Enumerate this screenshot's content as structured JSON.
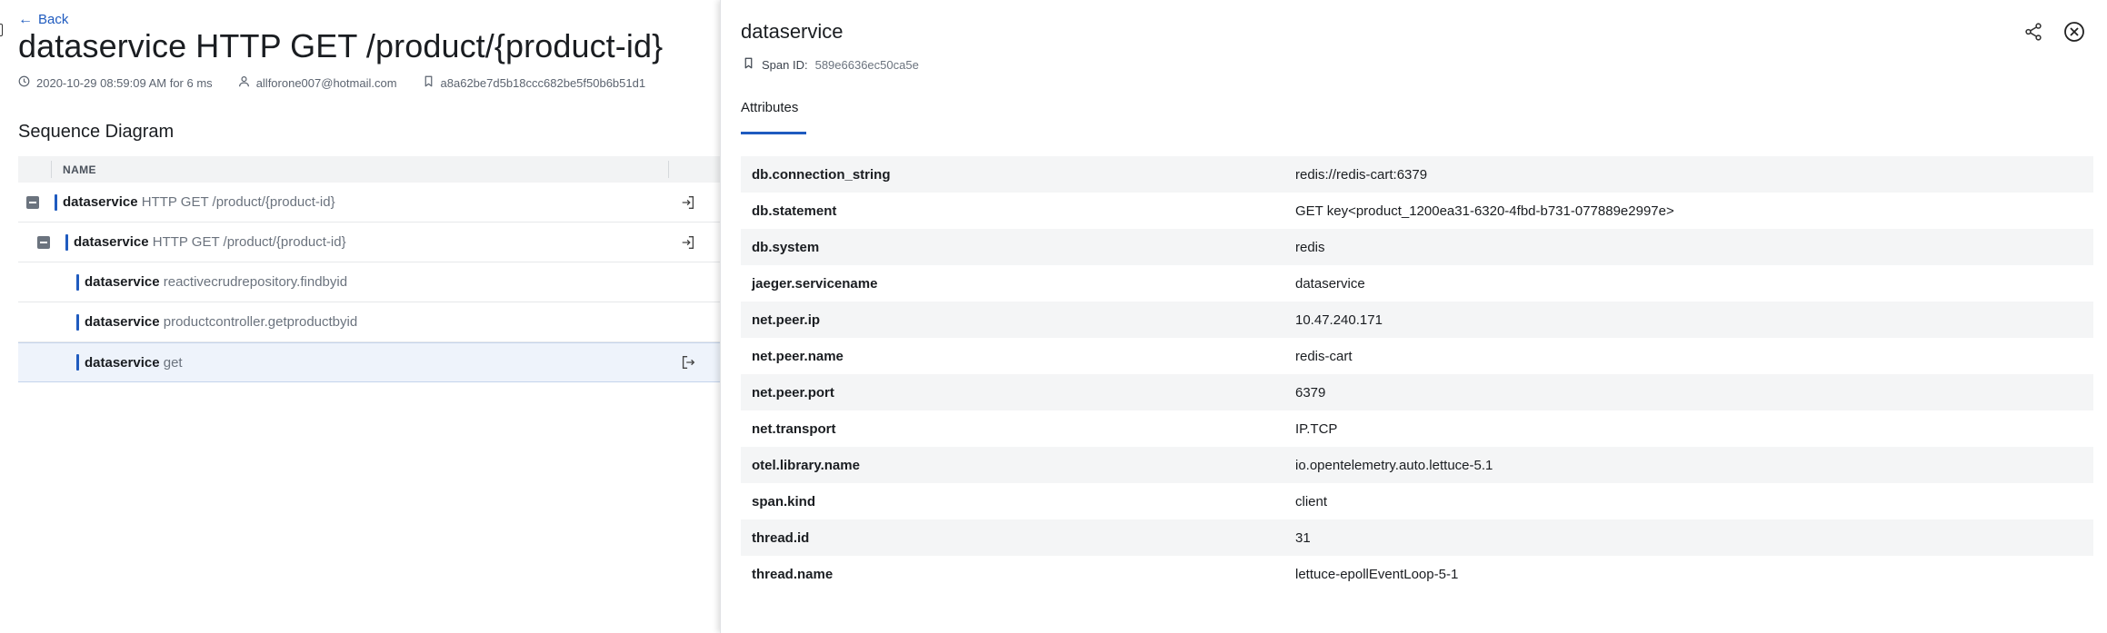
{
  "header": {
    "back_label": "Back",
    "title": "dataservice HTTP GET /product/{product-id}",
    "meta": {
      "timestamp": "2020-10-29 08:59:09 AM for 6 ms",
      "user": "allforone007@hotmail.com",
      "trace_id": "a8a62be7d5b18ccc682be5f50b6b51d1"
    }
  },
  "sequence": {
    "title": "Sequence Diagram",
    "column_name": "NAME",
    "rows": [
      {
        "service": "dataservice",
        "operation": "HTTP GET /product/{product-id}"
      },
      {
        "service": "dataservice",
        "operation": "HTTP GET /product/{product-id}"
      },
      {
        "service": "dataservice",
        "operation": "reactivecrudrepository.findbyid"
      },
      {
        "service": "dataservice",
        "operation": "productcontroller.getproductbyid"
      },
      {
        "service": "dataservice",
        "operation": "get"
      }
    ]
  },
  "panel": {
    "title": "dataservice",
    "span_id_label": "Span ID:",
    "span_id_value": "589e6636ec50ca5e",
    "tabs": [
      {
        "label": "Attributes"
      }
    ],
    "attributes": [
      {
        "key": "db.connection_string",
        "value": "redis://redis-cart:6379"
      },
      {
        "key": "db.statement",
        "value": "GET key<product_1200ea31-6320-4fbd-b731-077889e2997e>"
      },
      {
        "key": "db.system",
        "value": "redis"
      },
      {
        "key": "jaeger.servicename",
        "value": "dataservice"
      },
      {
        "key": "net.peer.ip",
        "value": "10.47.240.171"
      },
      {
        "key": "net.peer.name",
        "value": "redis-cart"
      },
      {
        "key": "net.peer.port",
        "value": "6379"
      },
      {
        "key": "net.transport",
        "value": "IP.TCP"
      },
      {
        "key": "otel.library.name",
        "value": "io.opentelemetry.auto.lettuce-5.1"
      },
      {
        "key": "span.kind",
        "value": "client"
      },
      {
        "key": "thread.id",
        "value": "31"
      },
      {
        "key": "thread.name",
        "value": "lettuce-epollEventLoop-5-1"
      }
    ]
  },
  "colors": {
    "accent": "#1f5bbf",
    "selected_row": "#eef3fb",
    "stripe": "#f4f5f6"
  }
}
